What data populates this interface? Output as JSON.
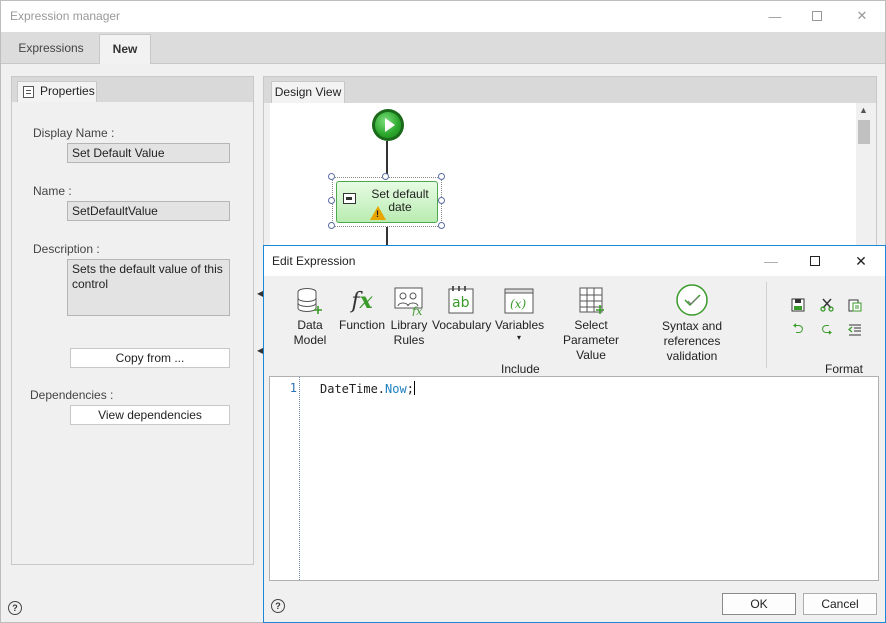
{
  "window": {
    "title": "Expression manager",
    "tabs": [
      {
        "label": "Expressions",
        "active": false
      },
      {
        "label": "New",
        "active": true
      }
    ]
  },
  "properties": {
    "tab_label": "Properties",
    "display_name_label": "Display Name :",
    "display_name_value": "Set Default Value",
    "name_label": "Name :",
    "name_value": "SetDefaultValue",
    "description_label": "Description :",
    "description_value": "Sets the default value of this control",
    "copy_from_label": "Copy from ...",
    "dependencies_label": "Dependencies :",
    "view_dependencies_label": "View dependencies"
  },
  "design_view": {
    "tab_label": "Design View",
    "node_label": "Set default date"
  },
  "dialog": {
    "title": "Edit Expression",
    "ribbon": {
      "items": [
        {
          "label": "Data Model",
          "icon": "database-add-icon"
        },
        {
          "label": "Function",
          "icon": "function-fx-icon"
        },
        {
          "label": "Library Rules",
          "icon": "library-rules-icon"
        },
        {
          "label": "Vocabulary",
          "icon": "vocabulary-icon"
        },
        {
          "label": "Variables",
          "icon": "variables-icon"
        },
        {
          "label": "Select Parameter Value",
          "icon": "select-parameter-icon"
        },
        {
          "label": "Syntax and references validation",
          "icon": "validation-check-icon"
        }
      ],
      "include_group": "Include",
      "format_group": "Format"
    },
    "editor": {
      "line_number": "1",
      "code_object": "DateTime",
      "code_dot": ".",
      "code_member": "Now",
      "code_end": ";"
    },
    "ok_label": "OK",
    "cancel_label": "Cancel"
  },
  "colors": {
    "dialog_border": "#1e86d6",
    "node_fill": "#b9ecb1",
    "start_green": "#2aa52a",
    "code_member": "#1f80c0"
  }
}
